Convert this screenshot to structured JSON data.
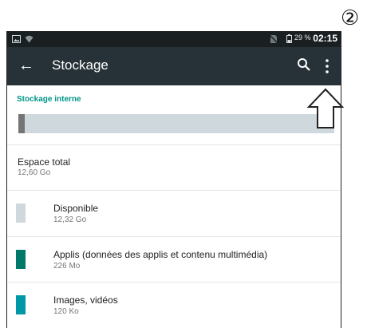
{
  "callout": {
    "number": "②"
  },
  "status_bar": {
    "left_icons": [
      "image-icon",
      "wifi-icon"
    ],
    "right_icons": [
      "no-sim-icon",
      "battery-icon"
    ],
    "battery": "29 %",
    "time": "02:15"
  },
  "app_bar": {
    "title": "Stockage",
    "icons": [
      "back-arrow-icon",
      "search-icon",
      "overflow-menu-icon"
    ]
  },
  "internal_storage": {
    "header": "Stockage interne",
    "used_fraction": 0.02,
    "colors": {
      "used": "#757575",
      "free": "#cfd8dc"
    }
  },
  "total": {
    "title": "Espace total",
    "value": "12,60 Go"
  },
  "items": [
    {
      "title": "Disponible",
      "value": "12,32 Go",
      "color": "#cfd8dc"
    },
    {
      "title": "Applis (données des applis et contenu multimédia)",
      "value": "226 Mo",
      "color": "#00796b"
    },
    {
      "title": "Images, vidéos",
      "value": "120 Ko",
      "color": "#0097a7"
    }
  ],
  "accent_color": "#009688"
}
